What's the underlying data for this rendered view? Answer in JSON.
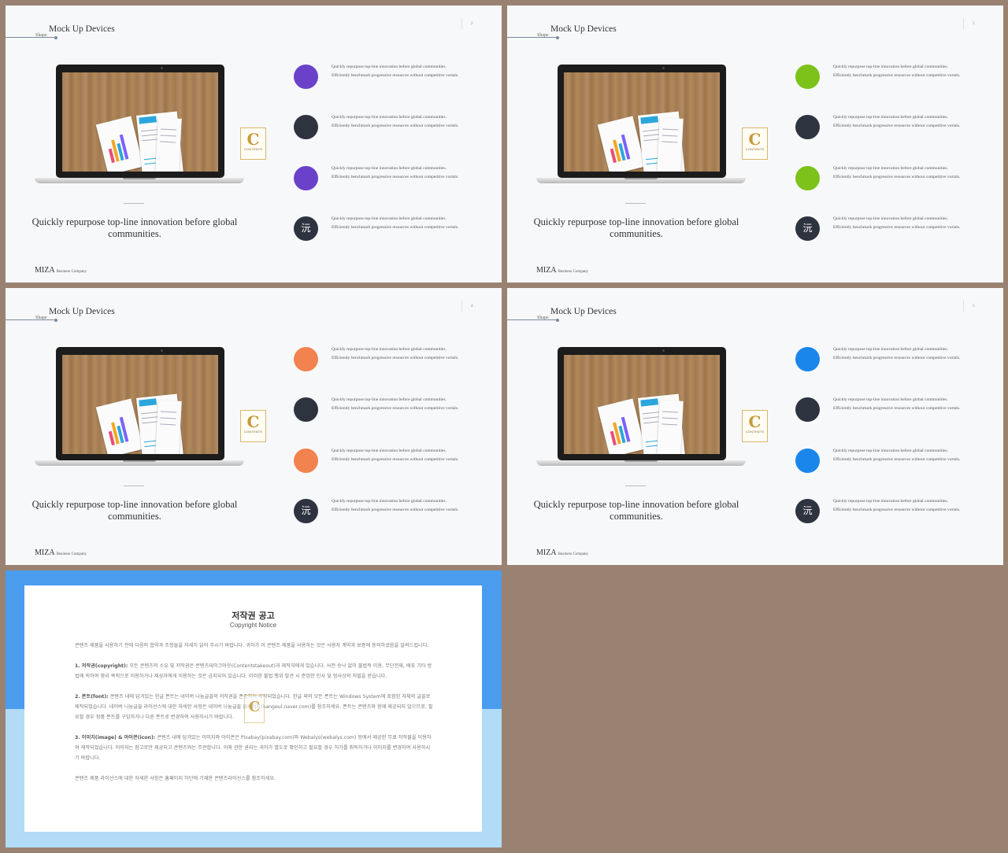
{
  "slides": [
    {
      "section_label": "Shape",
      "title": "Mock Up Devices",
      "page": "2",
      "caption": "Quickly repurpose top-line innovation before global communities.",
      "brand": "MIZA",
      "brand_sub": "Business Company",
      "badge_text": "CONTENTS",
      "items": [
        {
          "color": "#6a42c9",
          "glyph": "",
          "text": "Quickly repurpose top-line innovation before global communities. Efficiently benchmark progressive resources without competitive vortals."
        },
        {
          "color": "#2e3340",
          "glyph": "",
          "text": "Quickly repurpose top-line innovation before global communities. Efficiently benchmark progressive resources without competitive vortals."
        },
        {
          "color": "#6a42c9",
          "glyph": "",
          "text": "Quickly repurpose top-line innovation before global communities. Efficiently benchmark progressive resources without competitive vortals."
        },
        {
          "color": "#2e3340",
          "glyph": "沅",
          "text": "Quickly repurpose top-line innovation before global communities. Efficiently benchmark progressive resources without competitive vortals."
        }
      ]
    },
    {
      "section_label": "Shape",
      "title": "Mock Up Devices",
      "page": "3",
      "caption": "Quickly repurpose top-line innovation before global communities.",
      "brand": "MIZA",
      "brand_sub": "Business Company",
      "badge_text": "CONTENTS",
      "items": [
        {
          "color": "#7cc21a",
          "glyph": "",
          "text": "Quickly repurpose top-line innovation before global communities. Efficiently benchmark progressive resources without competitive vortals."
        },
        {
          "color": "#2e3340",
          "glyph": "",
          "text": "Quickly repurpose top-line innovation before global communities. Efficiently benchmark progressive resources without competitive vortals."
        },
        {
          "color": "#7cc21a",
          "glyph": "",
          "text": "Quickly repurpose top-line innovation before global communities. Efficiently benchmark progressive resources without competitive vortals."
        },
        {
          "color": "#2e3340",
          "glyph": "沅",
          "text": "Quickly repurpose top-line innovation before global communities. Efficiently benchmark progressive resources without competitive vortals."
        }
      ]
    },
    {
      "section_label": "Shape",
      "title": "Mock Up Devices",
      "page": "4",
      "caption": "Quickly repurpose top-line innovation before global communities.",
      "brand": "MIZA",
      "brand_sub": "Business Company",
      "badge_text": "CONTENTS",
      "items": [
        {
          "color": "#f2824e",
          "glyph": "",
          "text": "Quickly repurpose top-line innovation before global communities. Efficiently benchmark progressive resources without competitive vortals."
        },
        {
          "color": "#2e3340",
          "glyph": "",
          "text": "Quickly repurpose top-line innovation before global communities. Efficiently benchmark progressive resources without competitive vortals."
        },
        {
          "color": "#f2824e",
          "glyph": "",
          "text": "Quickly repurpose top-line innovation before global communities. Efficiently benchmark progressive resources without competitive vortals."
        },
        {
          "color": "#2e3340",
          "glyph": "沅",
          "text": "Quickly repurpose top-line innovation before global communities. Efficiently benchmark progressive resources without competitive vortals."
        }
      ]
    },
    {
      "section_label": "Shape",
      "title": "Mock Up Devices",
      "page": "5",
      "caption": "Quickly repurpose top-line innovation before global communities.",
      "brand": "MIZA",
      "brand_sub": "Business Company",
      "badge_text": "CONTENTS",
      "items": [
        {
          "color": "#1a86ec",
          "glyph": "",
          "text": "Quickly repurpose top-line innovation before global communities. Efficiently benchmark progressive resources without competitive vortals."
        },
        {
          "color": "#2e3340",
          "glyph": "",
          "text": "Quickly repurpose top-line innovation before global communities. Efficiently benchmark progressive resources without competitive vortals."
        },
        {
          "color": "#1a86ec",
          "glyph": "",
          "text": "Quickly repurpose top-line innovation before global communities. Efficiently benchmark progressive resources without competitive vortals."
        },
        {
          "color": "#2e3340",
          "glyph": "沅",
          "text": "Quickly repurpose top-line innovation before global communities. Efficiently benchmark progressive resources without competitive vortals."
        }
      ]
    }
  ],
  "notice": {
    "title": "저작권 공고",
    "subtitle": "Copyright Notice",
    "paragraphs": [
      {
        "label": "",
        "text": "콘텐츠 제품을 사용하기 전에 다음의 협약과 조항들을 자세히 읽어 주시기 바랍니다. 귀하가 이 콘텐츠 제품을 사용하는 것은 사용자 계약과 보증에 동의하셨음을 알려드립니다."
      },
      {
        "label": "1. 저작권(copyright):",
        "text": " 모든 콘텐츠의 소유 및 저작권은 콘텐츠테이크아웃(Contentstakeout)과 제작자에게 있습니다. 사전 승낙 없이 불법적 이용, 무단전재, 배포 기타 방법에 의하여 영리 목적으로 이용하거나 제삼자에게 이용하는 것은 금지되어 있습니다. 이러한 불법 행위 발견 시 준엄한 민사 및 형사상의 처벌을 받습니다."
      },
      {
        "label": "2. 폰트(font):",
        "text": " 콘텐츠 내에 담겨있는 한글 폰트는 네이버 나눔글꼴의 저작권을 존중하여 제작되었습니다. 한글 외의 모든 폰트는 Windows System에 포함된 자체의 글꼴로 제작되었습니다. 네이버 나눔글꼴 라이선스에 대한 자세한 사항은 네이버 나눔글꼴 홈페이지(hangeul.naver.com)를 참조하세요. 폰트는 콘텐츠와 함께 제공되지 않으므로, 필요할 경우 정품 폰트를 구입하거나 다른 폰트로 변경하여 사용하시기 바랍니다."
      },
      {
        "label": "3. 이미지(image) & 아이콘(icon):",
        "text": " 콘텐츠 내에 담겨있는 이미지와 아이콘은 Pixabay(pixabay.com)와 Webalys(webalys.com) 등에서 제공한 무료 저작물을 이용하여 제작되었습니다. 이미지는 참고로만 제공되고 콘텐츠와는 무관합니다. 이에 관한 권리는 귀하가 별도로 확인하고 필요할 경우 허가를 취득하거나 이미지를 변경하여 사용하시기 바랍니다."
      },
      {
        "label": "",
        "text": "콘텐츠 제품 라이선스에 대한 자세한 사항은 홈페이지 하단에 기재한 콘텐츠라이선스를 참조하세요."
      }
    ]
  }
}
